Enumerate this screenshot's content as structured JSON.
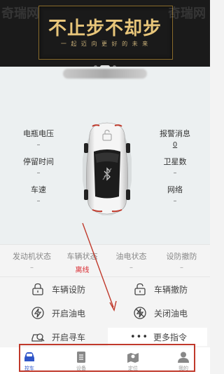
{
  "banner": {
    "title": "不止步不却步",
    "subtitle": "一 起 迈 向 更 好 的 未 来",
    "watermark_left": "奇瑞网",
    "watermark_right": "奇瑞网",
    "slide_count": 3,
    "active_slide": 1
  },
  "metrics": {
    "battery_voltage": {
      "label": "电瓶电压",
      "value": "–"
    },
    "parking_time": {
      "label": "停留时间",
      "value": "–"
    },
    "speed": {
      "label": "车速",
      "value": "–"
    },
    "alarm_messages": {
      "label": "报警消息",
      "value": "0"
    },
    "satellites": {
      "label": "卫星数",
      "value": "–"
    },
    "network": {
      "label": "网络",
      "value": "–"
    }
  },
  "status": {
    "engine": {
      "label": "发动机状态",
      "value": "–"
    },
    "vehicle": {
      "label": "车辆状态",
      "value": "离线"
    },
    "fuel_power": {
      "label": "油电状态",
      "value": "–"
    },
    "arm_disarm": {
      "label": "设防撤防",
      "value": "–"
    }
  },
  "controls": {
    "arm": "车辆设防",
    "disarm": "车辆撤防",
    "fuel_on": "开启油电",
    "fuel_off": "关闭油电",
    "find_car": "开启寻车",
    "more": "更多指令",
    "more_icon": "•••"
  },
  "tabs": [
    {
      "label": "控车",
      "icon": "car-icon",
      "active": true
    },
    {
      "label": "设备",
      "icon": "document-icon",
      "active": false
    },
    {
      "label": "定位",
      "icon": "map-icon",
      "active": false
    },
    {
      "label": "我的",
      "icon": "user-icon",
      "active": false
    }
  ],
  "colors": {
    "accent": "#2f55c8",
    "offline_red": "#d9262c",
    "annotation_red": "#c0392b",
    "banner_gold": "#e8c67a"
  }
}
